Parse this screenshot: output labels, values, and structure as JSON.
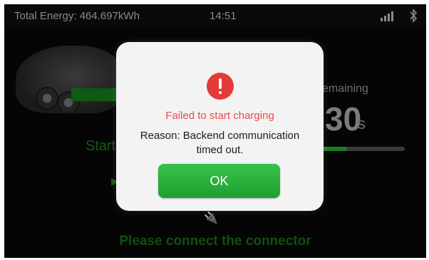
{
  "status_bar": {
    "total_energy": "Total Energy: 464.697kWh",
    "time": "14:51",
    "signal_icon": "signal-bars-icon",
    "bluetooth_icon": "bluetooth-icon"
  },
  "background": {
    "start_label_partial": "Start",
    "remaining_label_partial": "emaining",
    "countdown_partial": "30",
    "countdown_unit": "s",
    "progress_fraction": 0.3,
    "connect_prompt": "Please connect the connector"
  },
  "dialog": {
    "icon": "exclamation-icon",
    "title": "Failed to start charging",
    "reason": "Reason: Backend communication timed out.",
    "ok_label": "OK"
  },
  "colors": {
    "accent_green": "#28b03a",
    "error_red": "#e33a3a"
  }
}
